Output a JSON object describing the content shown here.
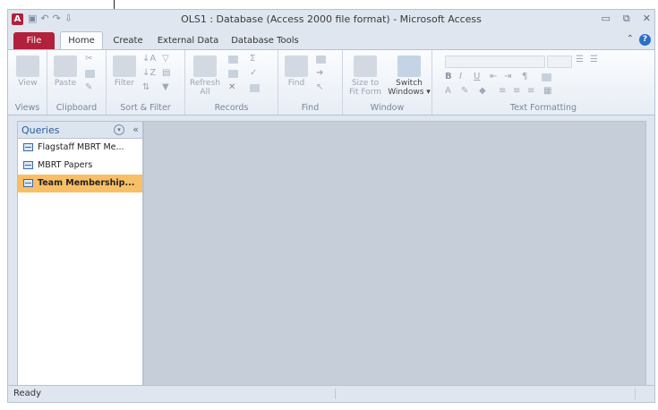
{
  "window": {
    "app_icon_label": "A",
    "title": "OLS1 : Database (Access 2000 file format) - Microsoft Access",
    "controls": [
      "▭",
      "⧉",
      "✕"
    ]
  },
  "ribbon": {
    "tabs": [
      "File",
      "Home",
      "Create",
      "External Data",
      "Database Tools"
    ],
    "active_tab": "Home",
    "groups": [
      {
        "label": "Views",
        "buttons": [
          "View"
        ]
      },
      {
        "label": "Clipboard",
        "buttons": [
          "Paste"
        ]
      },
      {
        "label": "Sort & Filter",
        "buttons": [
          "Filter"
        ]
      },
      {
        "label": "Records",
        "buttons": [
          "Refresh All"
        ]
      },
      {
        "label": "Find",
        "buttons": [
          "Find"
        ]
      },
      {
        "label": "Window",
        "buttons": [
          "Size to Fit Form",
          "Switch Windows"
        ]
      },
      {
        "label": "Text Formatting",
        "buttons": []
      }
    ],
    "window_size_label_1": "Size to",
    "window_size_label_2": "Fit Form",
    "switch_label_1": "Switch",
    "switch_label_2": "Windows ▾",
    "refresh_label_1": "Refresh",
    "refresh_label_2": "All"
  },
  "nav_pane": {
    "title": "Queries",
    "items": [
      {
        "label": "Flagstaff MBRT Me...",
        "selected": false
      },
      {
        "label": "MBRT Papers",
        "selected": false
      },
      {
        "label": "Team Membership...",
        "selected": true
      }
    ]
  },
  "status": {
    "text": "Ready"
  },
  "colors": {
    "file_tab": "#b2213b",
    "selected_item": "#f9bf66",
    "workspace": "#c6ced9"
  }
}
